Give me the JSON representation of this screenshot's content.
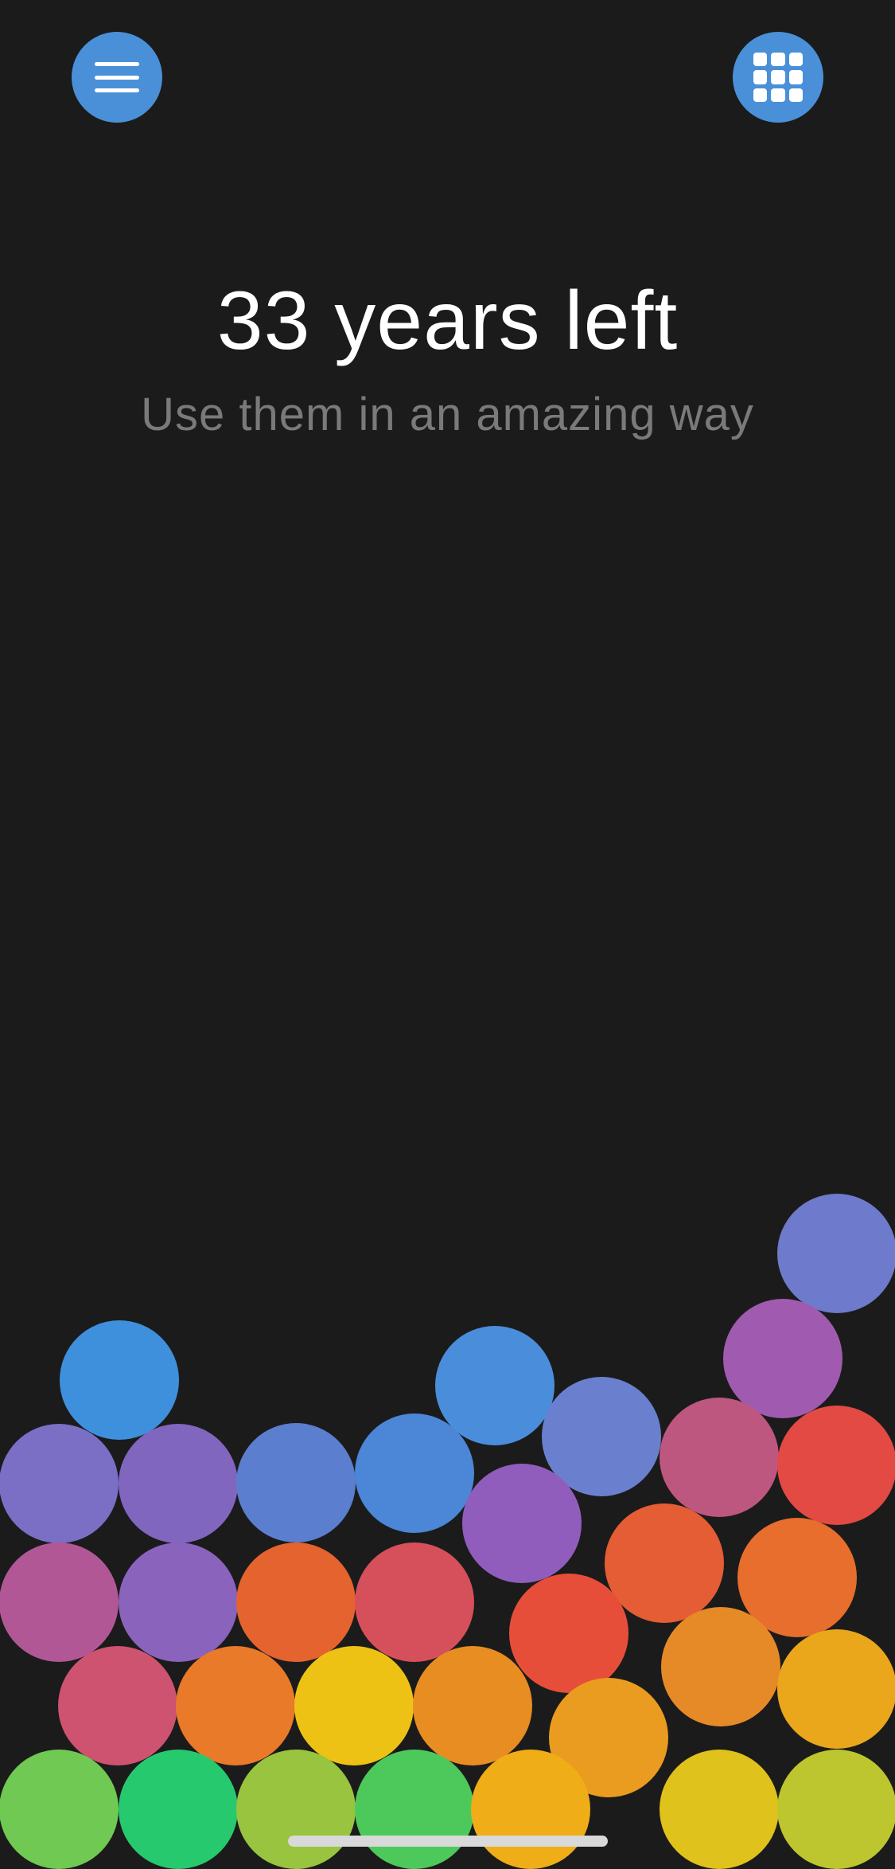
{
  "header": {
    "menu_button": {
      "icon": "hamburger-menu-icon",
      "color": "#4a90d9"
    },
    "grid_button": {
      "icon": "grid-icon",
      "color": "#4a90d9"
    }
  },
  "main": {
    "title": "33 years left",
    "subtitle": "Use them in an amazing way"
  },
  "balls": [
    "#6e7acb",
    "#a05bb0",
    "#3f90dc",
    "#4a8edb",
    "#6a80cf",
    "#be577f",
    "#e24a43",
    "#7a6fc5",
    "#8166bf",
    "#5b7ecf",
    "#4c86d6",
    "#915dbc",
    "#b15796",
    "#8a63bd",
    "#e5632f",
    "#d5505a",
    "#e55d34",
    "#e76e2c",
    "#e74e3a",
    "#cd5370",
    "#e87a2a",
    "#eec214",
    "#e88d22",
    "#e68a27",
    "#e99c1f",
    "#eaa71c",
    "#70c952",
    "#27c96f",
    "#98c43f",
    "#4dc95b",
    "#efad17",
    "#dfc21c",
    "#bdc62e"
  ],
  "colors": {
    "background": "#1b1b1b",
    "title": "#ffffff",
    "subtitle": "#7a7a7a",
    "home_indicator": "#d9d9d9"
  }
}
